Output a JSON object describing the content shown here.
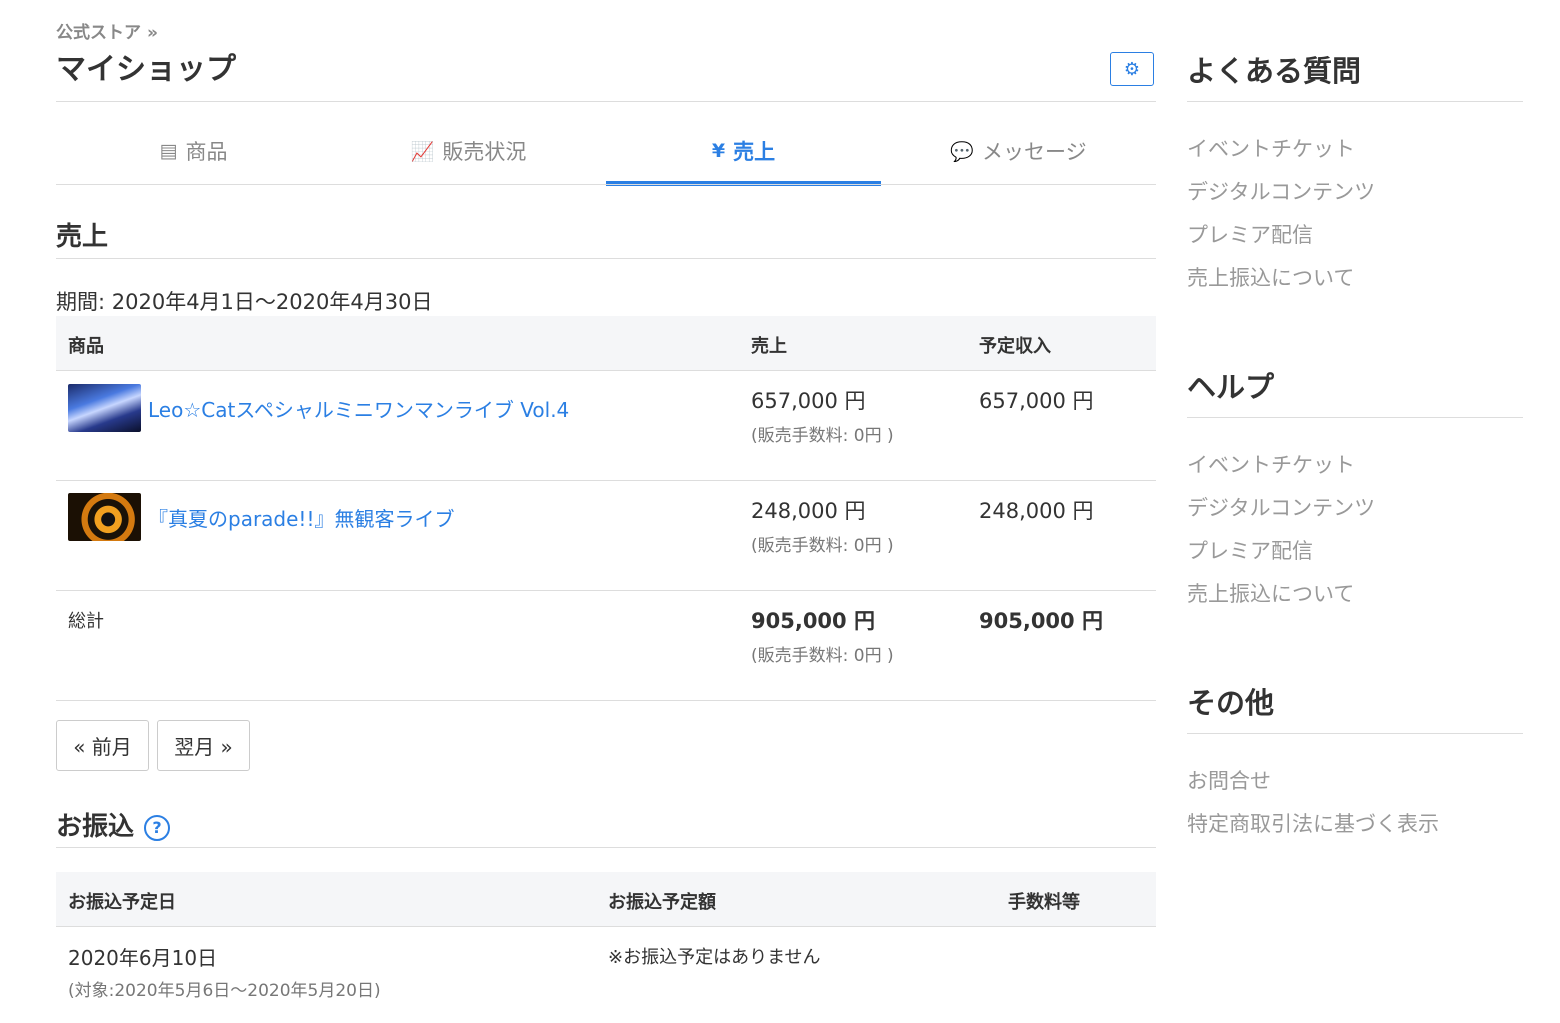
{
  "breadcrumb": {
    "label": "公式ストア",
    "sep": "»"
  },
  "page_title": "マイショップ",
  "tabs": [
    {
      "label": "商品",
      "icon": "list-icon",
      "glyph": "▤",
      "active": false
    },
    {
      "label": "販売状況",
      "icon": "chart-icon",
      "glyph": "📈",
      "active": false
    },
    {
      "label": "売上",
      "icon": "yen-icon",
      "glyph": "¥",
      "active": true
    },
    {
      "label": "メッセージ",
      "icon": "chat-icon",
      "glyph": "💬",
      "active": false
    }
  ],
  "sales": {
    "title": "売上",
    "period": "期間: 2020年4月1日〜2020年4月30日",
    "headers": {
      "product": "商品",
      "sales": "売上",
      "expected": "予定収入"
    },
    "rows": [
      {
        "name": "Leo☆Catスペシャルミニワンマンライブ Vol.4",
        "sales": "657,000 円",
        "fee": "(販売手数料: 0円 )",
        "expected": "657,000 円"
      },
      {
        "name": "『真夏のparade!!』無観客ライブ",
        "sales": "248,000 円",
        "fee": "(販売手数料: 0円 )",
        "expected": "248,000 円"
      }
    ],
    "total": {
      "label": "総計",
      "sales": "905,000 円",
      "fee": "(販売手数料: 0円 )",
      "expected": "905,000 円"
    }
  },
  "pager": {
    "prev": "« 前月",
    "next": "翌月 »"
  },
  "transfer": {
    "title": "お振込",
    "help": "?",
    "headers": {
      "date": "お振込予定日",
      "amount": "お振込予定額",
      "fee": "手数料等"
    },
    "row": {
      "date": "2020年6月10日",
      "range": "(対象:2020年5月6日〜2020年5月20日)",
      "amount": "※お振込予定はありません"
    }
  },
  "sidebar": {
    "faq": {
      "title": "よくある質問",
      "items": [
        "イベントチケット",
        "デジタルコンテンツ",
        "プレミア配信",
        "売上振込について"
      ]
    },
    "help": {
      "title": "ヘルプ",
      "items": [
        "イベントチケット",
        "デジタルコンテンツ",
        "プレミア配信",
        "売上振込について"
      ]
    },
    "other": {
      "title": "その他",
      "items": [
        "お問合せ",
        "特定商取引法に基づく表示"
      ]
    }
  },
  "colors": {
    "accent": "#2b7fe3",
    "muted": "#999999",
    "header_bg": "#f5f6f8"
  }
}
